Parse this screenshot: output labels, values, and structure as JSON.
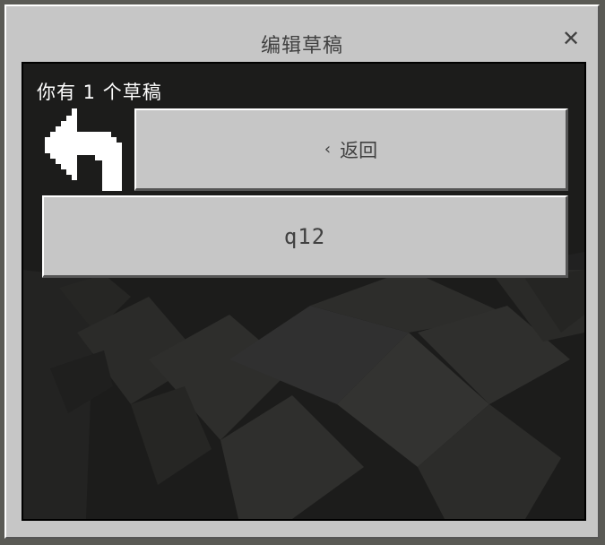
{
  "dialog": {
    "title": "编辑草稿",
    "close_icon": "close-icon"
  },
  "content": {
    "draft_count_text": "你有 1 个草稿",
    "back_icon": "back-arrow-icon",
    "back_button": {
      "chevron": "‹",
      "label": "返回"
    },
    "drafts": [
      {
        "name": "q12"
      }
    ]
  },
  "colors": {
    "dialog_bg": "#c6c6c6",
    "content_bg": "#1a1a19",
    "button_bg": "#c6c6c6",
    "text_dark": "#404040",
    "text_light": "#ffffff"
  }
}
